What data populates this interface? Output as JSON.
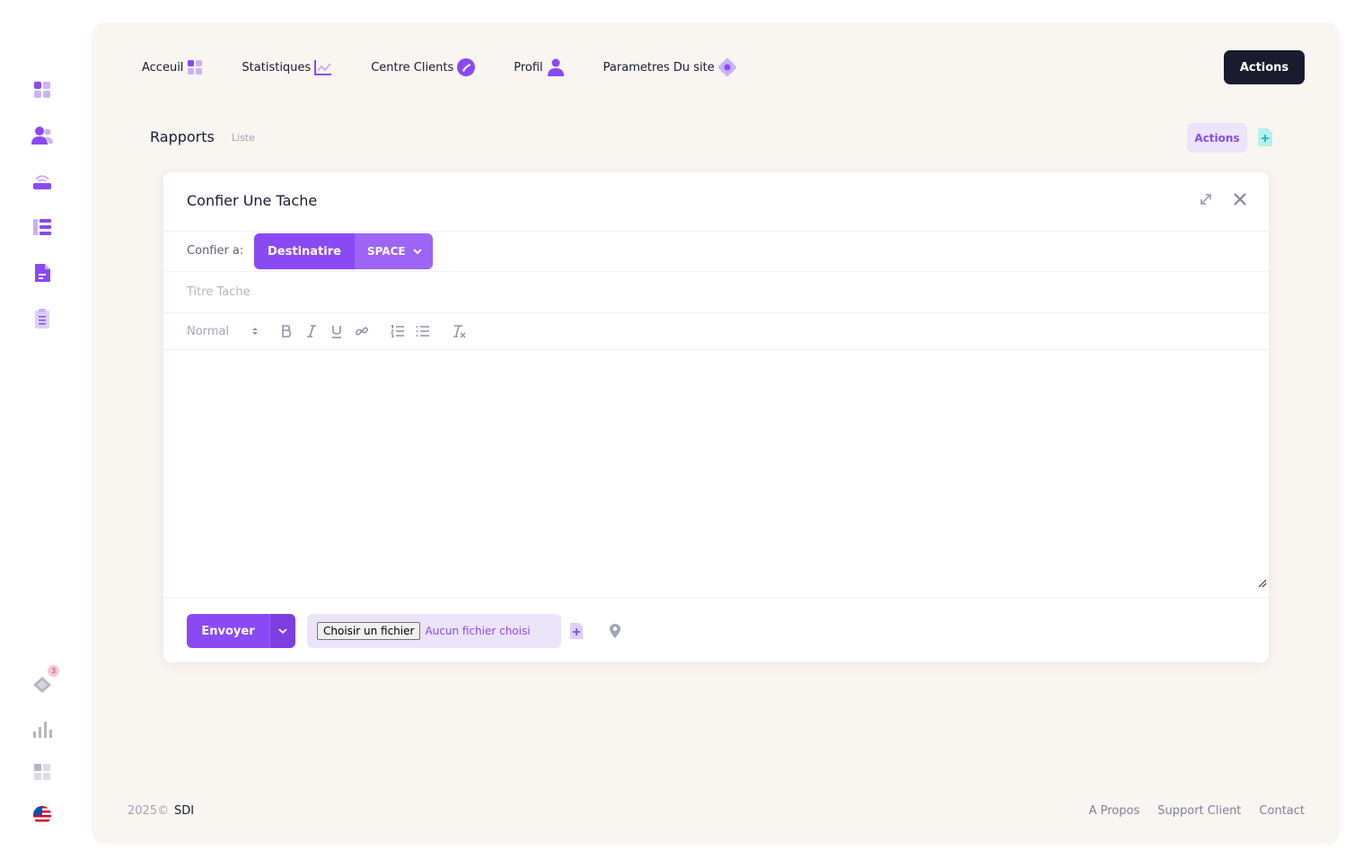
{
  "sidebar": {
    "icons": [
      "dashboard-icon",
      "users-icon",
      "router-icon",
      "list-icon",
      "document-icon",
      "clipboard-icon"
    ],
    "bottom": [
      {
        "icon": "tag-icon",
        "badge": "3"
      },
      {
        "icon": "bar-chart-icon"
      },
      {
        "icon": "apps-icon"
      },
      {
        "icon": "us-flag-icon"
      }
    ]
  },
  "topnav": {
    "items": [
      {
        "label": "Acceuil",
        "icon": "grid-icon"
      },
      {
        "label": "Statistiques",
        "icon": "line-chart-icon"
      },
      {
        "label": "Centre Clients",
        "icon": "phone-icon"
      },
      {
        "label": "Profil",
        "icon": "user-icon"
      },
      {
        "label": "Parametres Du site",
        "icon": "gear-icon"
      }
    ],
    "actions_label": "Actions"
  },
  "toolbar": {
    "title": "Rapports",
    "subtitle": "Liste",
    "actions_label": "Actions"
  },
  "modal": {
    "title": "Confier Une Tache",
    "assign_label": "Confier a:",
    "recipient_label": "Destinatire",
    "space_label": "SPACE",
    "title_placeholder": "Titre Tache",
    "format_select": "Normal",
    "send_label": "Envoyer",
    "choose_file_label": "Choisir un fichier",
    "no_file_label": "Aucun fichier choisi"
  },
  "footer": {
    "copyright": "2025©",
    "company": "SDI",
    "links": [
      "A Propos",
      "Support Client",
      "Contact"
    ]
  },
  "colors": {
    "accent": "#8a4af3",
    "accent_light": "#ece4fb",
    "dark": "#1b1b2f",
    "background": "#f9f5f0",
    "teal": "#1bc5bd"
  }
}
